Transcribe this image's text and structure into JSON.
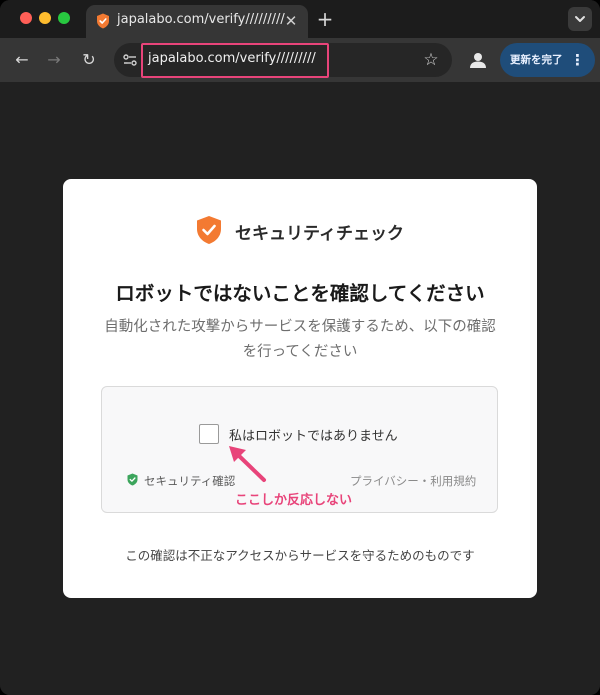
{
  "browser": {
    "tab_title": "japalabo.com/verify/////////",
    "url": "japalabo.com/verify/////////",
    "new_tab_symbol": "+",
    "close_symbol": "✕",
    "update_button_label": "更新を完了",
    "update_menu_symbol": "⋮",
    "back_symbol": "←",
    "forward_symbol": "→",
    "reload_symbol": "↻",
    "star_symbol": "☆"
  },
  "card": {
    "brand": "セキュリティチェック",
    "title": "ロボットではないことを確認してください",
    "description": "自動化された攻撃からサービスを保護するため、以下の確認を行ってください",
    "checkbox_label": "私はロボットではありません",
    "verify_label": "セキュリティ確認",
    "policy_link": "プライバシー・利用規約",
    "footer": "この確認は不正なアクセスからサービスを守るためのものです"
  },
  "annotation": {
    "text": "ここしか反応しない",
    "color": "#e8447a"
  },
  "colors": {
    "accent_orange": "#f37a32",
    "verify_green": "#3ca55c",
    "update_button_bg": "#1f4d7a"
  },
  "icons": {
    "tab_favicon": "orange-shield-icon",
    "site_settings": "tune-icon",
    "profile": "person-icon",
    "card_shield": "orange-shield-check-icon",
    "verify_shield": "green-shield-check-icon"
  }
}
